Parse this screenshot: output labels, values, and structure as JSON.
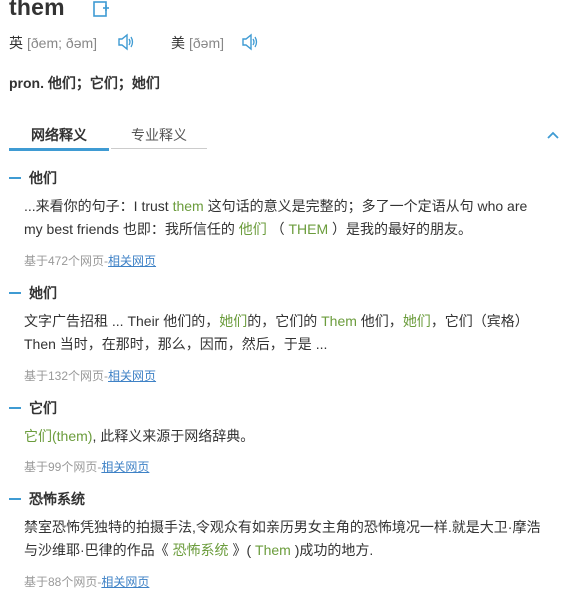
{
  "word": "them",
  "phonetics": {
    "uk": {
      "label": "英",
      "ipa": "[ðem; ðəm]"
    },
    "us": {
      "label": "美",
      "ipa": "[ðəm]"
    }
  },
  "translation": "pron. 他们；它们；她们",
  "tabs": {
    "web": "网络释义",
    "pro": "专业释义"
  },
  "entries": [
    {
      "title": "他们",
      "body": [
        {
          "t": "...来看你的句子：I trust ",
          "hl": false
        },
        {
          "t": "them",
          "hl": true
        },
        {
          "t": " 这句话的意义是完整的；多了一个定语从句 who are my best friends 也即：我所信任的 ",
          "hl": false
        },
        {
          "t": "他们",
          "hl": true
        },
        {
          "t": " （ ",
          "hl": false
        },
        {
          "t": "THEM",
          "hl": true
        },
        {
          "t": " ）是我的最好的朋友。",
          "hl": false
        }
      ],
      "meta_prefix": "基于472个网页-",
      "meta_link": "相关网页"
    },
    {
      "title": "她们",
      "body": [
        {
          "t": "文字广告招租 ... Their 他们的，",
          "hl": false
        },
        {
          "t": "她们",
          "hl": true
        },
        {
          "t": "的，它们的 ",
          "hl": false
        },
        {
          "t": "Them",
          "hl": true
        },
        {
          "t": " 他们，",
          "hl": false
        },
        {
          "t": "她们",
          "hl": true
        },
        {
          "t": "，它们（宾格） Then 当时，在那时，那么，因而，然后，于是 ...",
          "hl": false
        }
      ],
      "meta_prefix": "基于132个网页-",
      "meta_link": "相关网页"
    },
    {
      "title": "它们",
      "body": [
        {
          "t": "它们(them)",
          "hl": true
        },
        {
          "t": ", 此释义来源于网络辞典。",
          "hl": false
        }
      ],
      "meta_prefix": "基于99个网页-",
      "meta_link": "相关网页"
    },
    {
      "title": "恐怖系统",
      "body": [
        {
          "t": "禁室恐怖凭独特的拍摄手法,令观众有如亲历男女主角的恐怖境况一样.就是大卫·摩浩与沙维耶·巴律的作品《 ",
          "hl": false
        },
        {
          "t": "恐怖系统",
          "hl": true
        },
        {
          "t": " 》( ",
          "hl": false
        },
        {
          "t": "Them",
          "hl": true
        },
        {
          "t": " )成功的地方.",
          "hl": false
        }
      ],
      "meta_prefix": "基于88个网页-",
      "meta_link": "相关网页"
    }
  ],
  "colors": {
    "accent": "#3f9bd3",
    "highlight": "#6b9c3c",
    "link": "#3f82c6",
    "meta": "#999999"
  },
  "icons": {
    "add": "add-to-wordbook-icon",
    "speaker": "speaker-icon",
    "collapse": "chevron-up-icon"
  }
}
